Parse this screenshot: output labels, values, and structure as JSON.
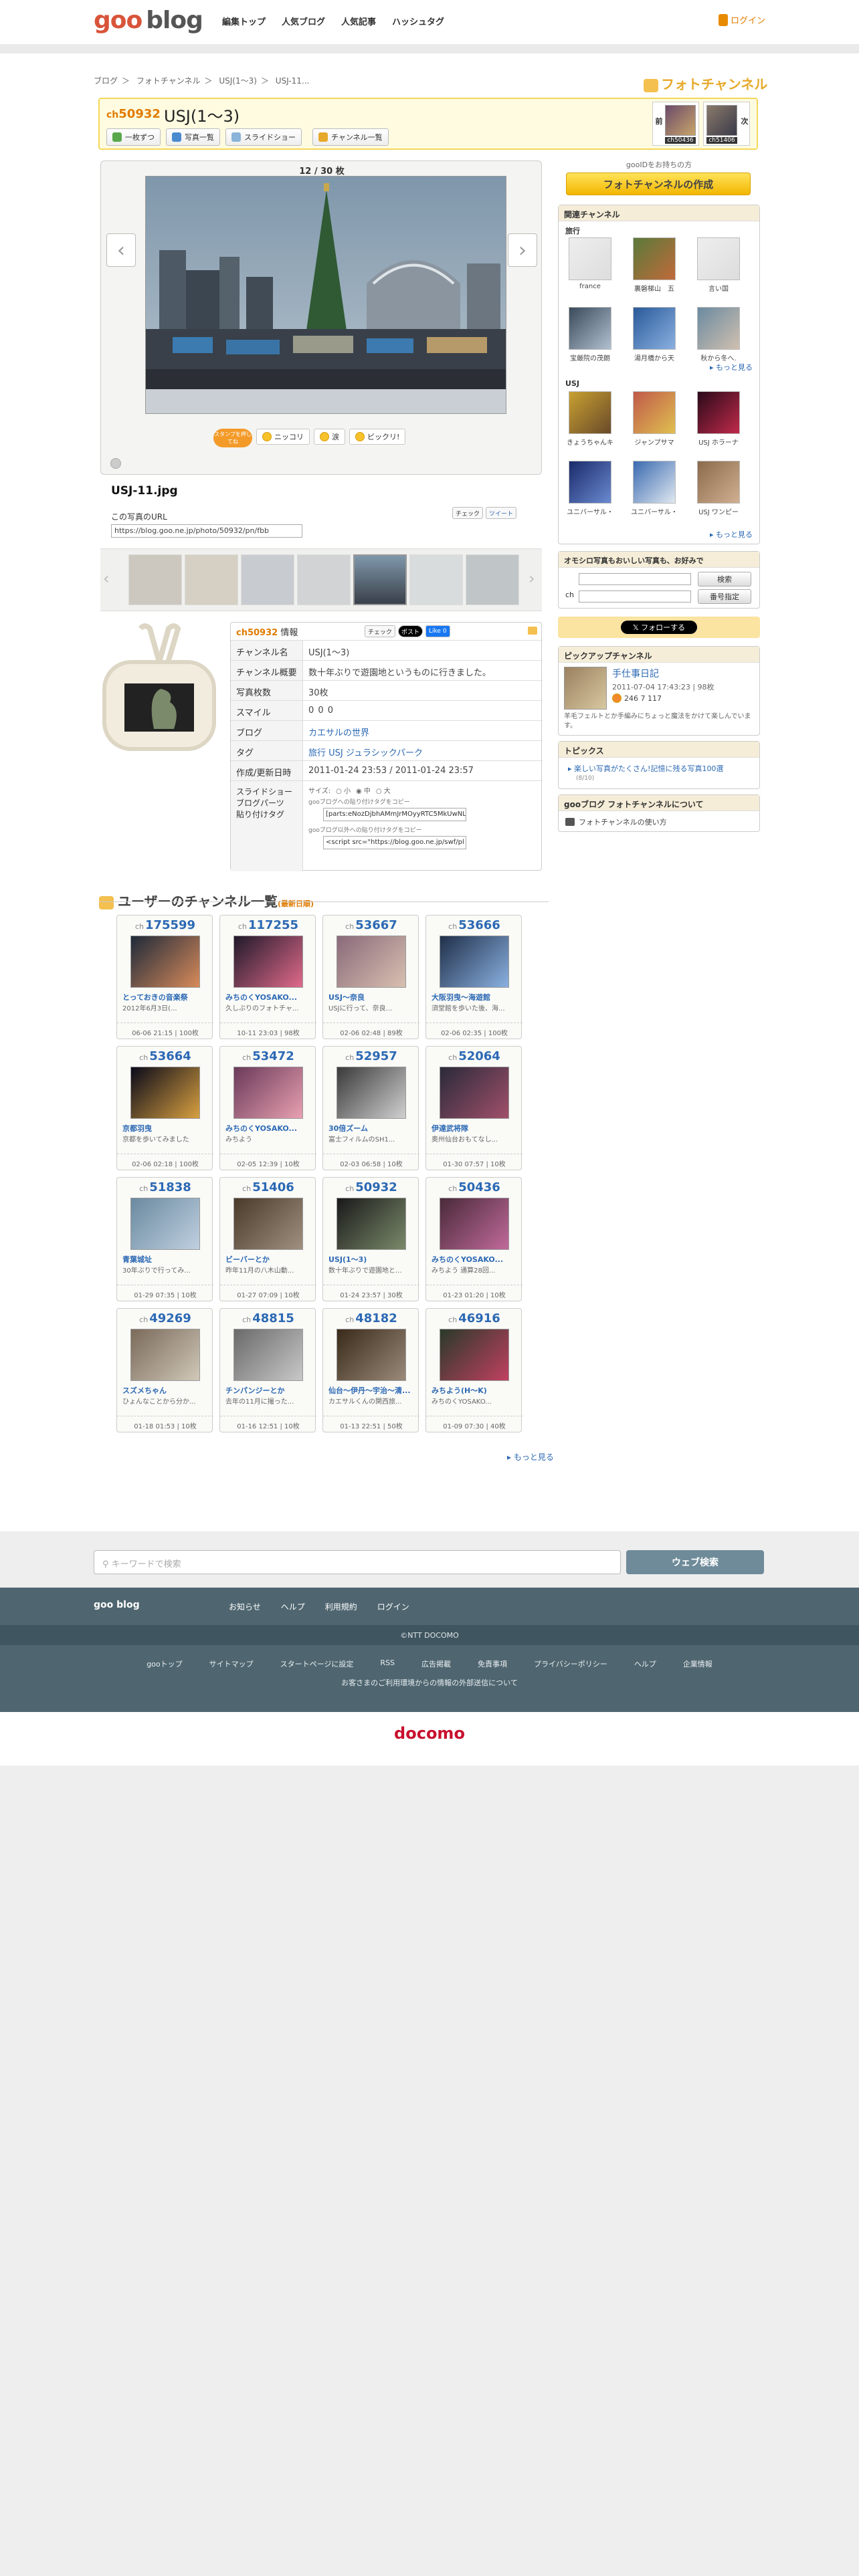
{
  "header": {
    "logo_goo": "goo",
    "logo_blog": "blog",
    "nav": [
      "編集トップ",
      "人気ブログ",
      "人気記事",
      "ハッシュタグ"
    ],
    "login": "ログイン"
  },
  "breadcrumb": [
    "ブログ",
    "＞",
    "フォトチャンネル",
    "＞",
    "USJ(1〜3)",
    "＞",
    "USJ-11..."
  ],
  "photochannel_logo": "フォトチャンネル",
  "channel": {
    "prefix": "ch",
    "number": "50932",
    "title": "USJ(1〜3)",
    "buttons": [
      "一枚ずつ",
      "写真一覧",
      "スライドショー",
      "チャンネル一覧"
    ],
    "prev_label": "前",
    "next_label": "次",
    "prev_no": "ch50436",
    "next_no": "ch51406"
  },
  "viewer": {
    "counter": "12 / 30 枚",
    "filename": "USJ-11.jpg",
    "stamp": "スタンプを押してね",
    "reactions": [
      "ニッコリ",
      "涙",
      "ビックリ!"
    ],
    "url_heading": "この写真のURL",
    "url_value": "https://blog.goo.ne.jp/photo/50932/pn/fbb",
    "share": [
      "チェック",
      "ツイート"
    ]
  },
  "info": {
    "header_no": "ch50932",
    "header_label": "情報",
    "share": [
      "チェック",
      "ポスト",
      "Like 0"
    ],
    "rows": [
      {
        "k": "チャンネル名",
        "v": "USJ(1〜3)"
      },
      {
        "k": "チャンネル概要",
        "v": "数十年ぶりで遊園地というものに行きました。"
      },
      {
        "k": "写真枚数",
        "v": "30枚"
      },
      {
        "k": "スマイル",
        "v": "0    0    0"
      },
      {
        "k": "ブログ",
        "v": "カエサルの世界"
      },
      {
        "k": "タグ",
        "v": "旅行    USJ    ジュラシックパーク"
      },
      {
        "k": "作成/更新日時",
        "v": "2011-01-24 23:53 / 2011-01-24 23:57"
      }
    ],
    "slideshow_label": "スライドショー\nブログパーツ\n貼り付けタグ",
    "size_label": "サイズ:",
    "sizes": [
      "小",
      "中",
      "大"
    ],
    "copy1_label": "gooブログへの貼り付けタグをコピー",
    "copy1_value": "[parts:eNozDjbhAMmJrMOyyRTC5MkUwNL",
    "copy2_label": "gooブログ以外への貼り付けタグをコピー",
    "copy2_value": "<script src=\"https://blog.goo.ne.jp/swf/pl"
  },
  "user_channels": {
    "heading": "ユーザーのチャンネル一覧",
    "sub": "(最新日順)",
    "more": "もっと見る",
    "cards": [
      {
        "no": "175599",
        "t": "とっておきの音楽祭",
        "d": "2012年6月3日(...",
        "m": "06-06 21:15 | 100枚"
      },
      {
        "no": "117255",
        "t": "みちのくYOSAKO...",
        "d": "久しぶりのフォトチャ...",
        "m": "10-11 23:03 | 98枚"
      },
      {
        "no": "53667",
        "t": "USJ〜奈良",
        "d": "USJに行って、奈良...",
        "m": "02-06 02:48 | 89枚"
      },
      {
        "no": "53666",
        "t": "大阪羽曳〜海遊館",
        "d": "須堂館を歩いた後、海...",
        "m": "02-06 02:35 | 100枚"
      },
      {
        "no": "53664",
        "t": "京都羽曳",
        "d": "京都を歩いてみました",
        "m": "02-06 02:18 | 100枚"
      },
      {
        "no": "53472",
        "t": "みちのくYOSAKO...",
        "d": "みちよう",
        "m": "02-05 12:39 | 10枚"
      },
      {
        "no": "52957",
        "t": "30倍ズーム",
        "d": "富士フィルムのSH1...",
        "m": "02-03 06:58 | 10枚"
      },
      {
        "no": "52064",
        "t": "伊達武将隊",
        "d": "奥州仙台おもてなし...",
        "m": "01-30 07:57 | 10枚"
      },
      {
        "no": "51838",
        "t": "青葉城址",
        "d": "30年ぶりで行ってみ...",
        "m": "01-29 07:35 | 10枚"
      },
      {
        "no": "51406",
        "t": "ビーバーとか",
        "d": "昨年11月の八木山動...",
        "m": "01-27 07:09 | 10枚"
      },
      {
        "no": "50932",
        "t": "USJ(1〜3)",
        "d": "数十年ぶりで遊園地と...",
        "m": "01-24 23:57 | 30枚"
      },
      {
        "no": "50436",
        "t": "みちのくYOSAKO...",
        "d": "みちよう 通算28回...",
        "m": "01-23 01:20 | 10枚"
      },
      {
        "no": "49269",
        "t": "スズメちゃん",
        "d": "ひょんなことから分か...",
        "m": "01-18 01:53 | 10枚"
      },
      {
        "no": "48815",
        "t": "チンパンジーとか",
        "d": "去年の11月に撮った...",
        "m": "01-16 12:51 | 10枚"
      },
      {
        "no": "48182",
        "t": "仙台〜伊丹〜宇治〜清...",
        "d": "カエサルくんの関西旅...",
        "m": "01-13 22:51 | 50枚"
      },
      {
        "no": "46916",
        "t": "みちよう(H〜K)",
        "d": "みちのくYOSAKO...",
        "m": "01-09 07:30 | 40枚"
      }
    ]
  },
  "sidebar": {
    "promo": "gooIDをお持ちの方",
    "create": "フォトチャンネルの作成",
    "related_h": "関連チャンネル",
    "travel_h": "旅行",
    "travel": [
      "france",
      "裏磐梯山　五",
      "言い国",
      "宝厳院の茂朗",
      "湯月橋から天",
      "秋から冬へ."
    ],
    "usj_h": "USJ",
    "usj": [
      "きょうちゃんキ",
      "ジャンプサマ",
      "USJ ホラーナ",
      "ユニバーサル・",
      "ユニバーサル・",
      "USJ ワンピー"
    ],
    "more": "もっと見る",
    "omoshiro_h": "オモシロ写真もおいしい写真も、お好みで",
    "search": "検索",
    "ch": "ch",
    "number_btn": "番号指定",
    "follow": "フォローする",
    "pickup_h": "ピックアップチャンネル",
    "pickup_title": "手仕事日記",
    "pickup_meta": "2011-07-04 17:43:23 | 98枚",
    "pickup_smile": "246    7    117",
    "pickup_desc": "羊毛フェルトとか手編みにちょっと魔法をかけて楽しんでいます。",
    "topics_h": "トピックス",
    "topic": "楽しい写真がたくさん!記憶に残る写真100選",
    "topic_date": "(8/10)",
    "about_h": "gooブログ フォトチャンネルについて",
    "about_link": "フォトチャンネルの使い方"
  },
  "footer": {
    "search_placeholder": "キーワードで検索",
    "search_btn": "ウェブ検索",
    "brand": "goo blog",
    "links1": [
      "お知らせ",
      "ヘルプ",
      "利用規約",
      "ログイン"
    ],
    "copyright": "©NTT DOCOMO",
    "links2": [
      "gooトップ",
      "サイトマップ",
      "スタートページに設定",
      "RSS",
      "広告掲載",
      "免責事項",
      "プライバシーポリシー",
      "ヘルプ",
      "企業情報"
    ],
    "notice": "お客さまのご利用環境からの情報の外部送信について",
    "docomo": "docomo"
  },
  "colors": {
    "accent": "#e07b00",
    "link": "#2c69b4",
    "gold": "#f2b600",
    "footer": "#4f6670"
  }
}
